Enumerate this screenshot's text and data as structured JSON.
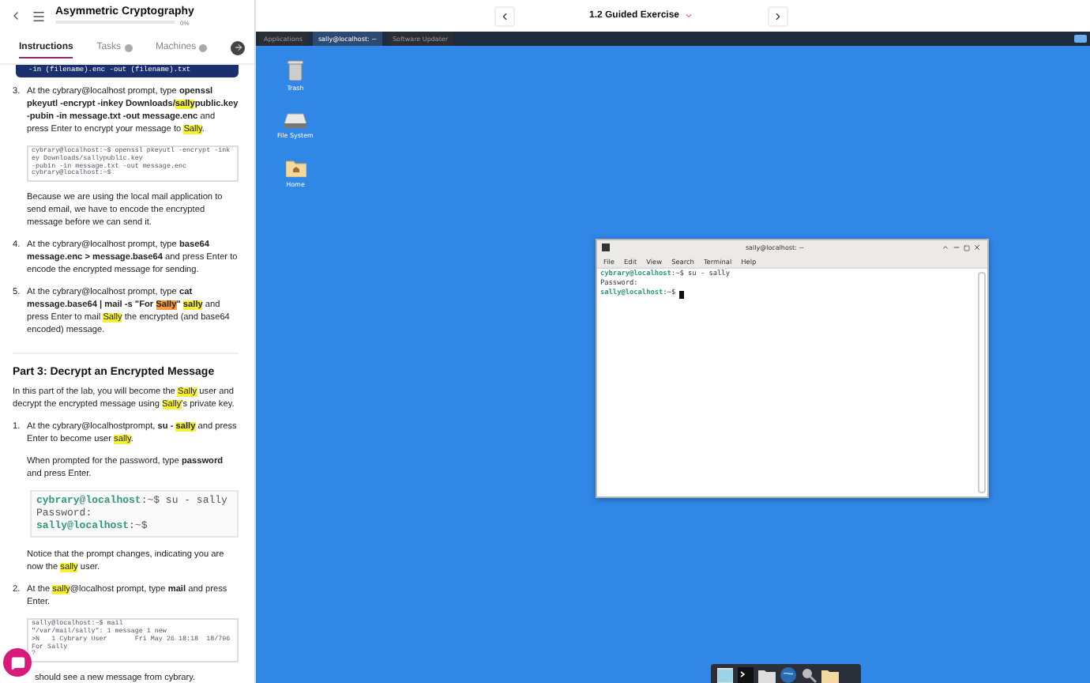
{
  "course": {
    "title": "Asymmetric Cryptography",
    "progress": {
      "level": 0,
      "label": "0%"
    }
  },
  "tabs": [
    {
      "label": "Instructions",
      "selected": true
    },
    {
      "label": "Tasks",
      "selected": false
    },
    {
      "label": "Machines",
      "selected": false
    }
  ],
  "content": [
    {
      "kind": "code-dark",
      "lines": [
        "-in (filename).enc -out (filename).txt"
      ]
    },
    {
      "kind": "step",
      "number": "3.",
      "parts": [
        {
          "text": "At the cybrary@localhost prompt, type ",
          "kind": "plain"
        },
        {
          "text": "openssl pkeyutl -encrypt -inkey Downloads/",
          "kind": "bold"
        },
        {
          "text": "sally",
          "kind": "bold-mark"
        },
        {
          "text": "public.key -pubin -in message.txt -out message.enc",
          "kind": "bold"
        },
        {
          "text": " and press Enter to encrypt your message to ",
          "kind": "plain"
        },
        {
          "text": "Sally",
          "kind": "mark"
        },
        {
          "text": ".",
          "kind": "plain"
        }
      ]
    },
    {
      "kind": "shot",
      "lines": [
        "cybrary@localhost:~$ openssl pkeyutl -encrypt -inkey Downloads/sallypublic.key",
        "-pubin -in message.txt -out message.enc",
        "cybrary@localhost:~$"
      ]
    },
    {
      "kind": "sub",
      "parts": [
        {
          "text": "Because we are using the local mail application to send email, we have to encode the encrypted message before we can send it.",
          "kind": "plain"
        }
      ]
    },
    {
      "kind": "step",
      "number": "4.",
      "parts": [
        {
          "text": "At the cybrary@localhost prompt, type ",
          "kind": "plain"
        },
        {
          "text": "base64 message.enc > message.base64",
          "kind": "bold"
        },
        {
          "text": " and press Enter to encode the encrypted message for sending.",
          "kind": "plain"
        }
      ]
    },
    {
      "kind": "step",
      "number": "5.",
      "parts": [
        {
          "text": "At the cybrary@localhost prompt, type ",
          "kind": "plain"
        },
        {
          "text": "cat message.base64 | mail -s \"For ",
          "kind": "bold"
        },
        {
          "text": "Sally",
          "kind": "bold-orange"
        },
        {
          "text": "\" ",
          "kind": "bold"
        },
        {
          "text": "sally",
          "kind": "bold-mark"
        },
        {
          "text": " and press Enter to mail ",
          "kind": "plain"
        },
        {
          "text": "Sally",
          "kind": "mark"
        },
        {
          "text": " the encrypted (and base64 encoded) message.",
          "kind": "plain"
        }
      ]
    },
    {
      "kind": "heading",
      "text": "Part 3: Decrypt an Encrypted Message"
    },
    {
      "kind": "para",
      "parts": [
        {
          "text": "In this part of the lab, you will become the ",
          "kind": "plain"
        },
        {
          "text": "Sally",
          "kind": "mark"
        },
        {
          "text": " user and decrypt the encrypted message using ",
          "kind": "plain"
        },
        {
          "text": "Sally",
          "kind": "mark"
        },
        {
          "text": "'s private key.",
          "kind": "plain"
        }
      ]
    },
    {
      "kind": "step",
      "number": "1.",
      "parts": [
        {
          "text": "At the cybrary@localhostprompt, ",
          "kind": "plain"
        },
        {
          "text": "su - ",
          "kind": "bold"
        },
        {
          "text": "sally",
          "kind": "bold-mark"
        },
        {
          "text": " and press Enter to become user ",
          "kind": "plain"
        },
        {
          "text": "sally",
          "kind": "mark"
        },
        {
          "text": ".",
          "kind": "plain"
        }
      ]
    },
    {
      "kind": "sub",
      "parts": [
        {
          "text": "When prompted for the password, type ",
          "kind": "plain"
        },
        {
          "text": "password",
          "kind": "bold"
        },
        {
          "text": " and press Enter.",
          "kind": "plain"
        }
      ]
    },
    {
      "kind": "console",
      "lines": [
        [
          {
            "text": "cybrary@localhost",
            "kind": "prompt"
          },
          {
            "text": ":~$ su - sally",
            "kind": "plain"
          }
        ],
        [
          {
            "text": "Password:",
            "kind": "plain"
          }
        ],
        [
          {
            "text": "sally@localhost",
            "kind": "prompt"
          },
          {
            "text": ":~$",
            "kind": "plain"
          }
        ]
      ]
    },
    {
      "kind": "sub",
      "parts": [
        {
          "text": "Notice that the prompt changes, indicating you are now the ",
          "kind": "plain"
        },
        {
          "text": "sally",
          "kind": "mark"
        },
        {
          "text": " user.",
          "kind": "plain"
        }
      ]
    },
    {
      "kind": "step",
      "number": "2.",
      "parts": [
        {
          "text": "At the ",
          "kind": "plain"
        },
        {
          "text": "sally",
          "kind": "mark"
        },
        {
          "text": "@localhost prompt, type ",
          "kind": "plain"
        },
        {
          "text": "mail",
          "kind": "bold"
        },
        {
          "text": " and press Enter.",
          "kind": "plain"
        }
      ]
    },
    {
      "kind": "shot",
      "lines": [
        "sally@localhost:~$ mail",
        "\"/var/mail/sally\": 1 message 1 new",
        ">N   1 Cybrary User       Fri May 26 18:18  18/796   For Sally",
        "?"
      ]
    },
    {
      "kind": "tail",
      "parts": [
        {
          "text": "should see a new message from cybrary.",
          "kind": "plain"
        }
      ]
    }
  ],
  "exercise": {
    "title": "1.2 Guided Exercise"
  },
  "taskbar": {
    "items": [
      {
        "label": "Applications",
        "selected": false
      },
      {
        "label": "sally@localhost: ~",
        "selected": true
      },
      {
        "label": "Software Updater",
        "selected": false
      }
    ]
  },
  "desktop_icons": [
    {
      "label": "Trash",
      "kind": "trash"
    },
    {
      "label": "File System",
      "kind": "drive"
    },
    {
      "label": "Home",
      "kind": "home"
    }
  ],
  "terminal": {
    "title": "sally@localhost: ~",
    "menu": [
      "File",
      "Edit",
      "View",
      "Search",
      "Terminal",
      "Help"
    ],
    "lines": [
      [
        {
          "text": "cybrary@localhost",
          "kind": "prompt"
        },
        {
          "text": ":~$ su - sally",
          "kind": "plain"
        }
      ],
      [
        {
          "text": "Password:",
          "kind": "plain"
        }
      ],
      [
        {
          "text": "sally@localhost",
          "kind": "prompt"
        },
        {
          "text": ":~$ ",
          "kind": "plain"
        }
      ]
    ]
  }
}
